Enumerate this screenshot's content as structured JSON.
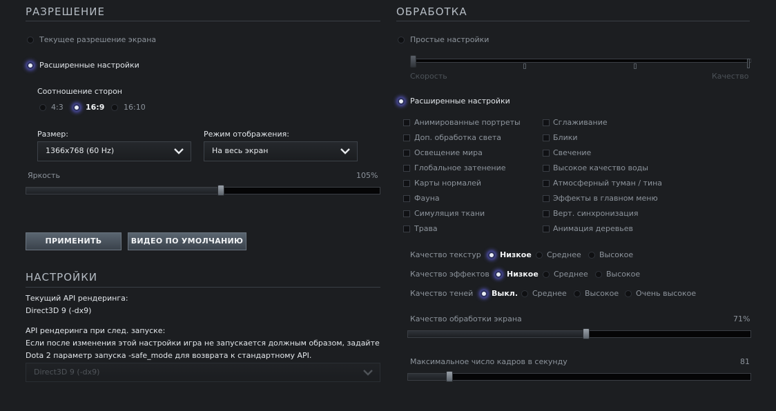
{
  "resolution": {
    "title": "РАЗРЕШЕНИЕ",
    "current_res_label": "Текущее разрешение экрана",
    "advanced_label": "Расширенные настройки",
    "aspect_label": "Соотношение сторон",
    "aspect_options": [
      "4:3",
      "16:9",
      "16:10"
    ],
    "size_label": "Размер:",
    "size_value": "1366x768 (60 Hz)",
    "display_mode_label": "Режим отображения:",
    "display_mode_value": "На весь экран",
    "brightness_label": "Яркость",
    "brightness_value": "105%",
    "brightness_fraction": 0.55,
    "apply_label": "ПРИМЕНИТЬ",
    "default_video_label": "ВИДЕО ПО УМОЛЧАНИЮ"
  },
  "settings": {
    "title": "НАСТРОЙКИ",
    "current_api_label": "Текущий API рендеринга:",
    "current_api_value": "Direct3D 9 (-dx9)",
    "next_api_label": "API рендеринга при след. запуске:",
    "warning_line1": "Если после изменения этой настройки игра не запускается должным образом, задайте",
    "warning_line2": "Dota 2 параметр запуска -safe_mode для возврата к стандартному API.",
    "api_select_value": "Direct3D 9 (-dx9)"
  },
  "rendering": {
    "title": "ОБРАБОТКА",
    "simple_label": "Простые настройки",
    "speed_label": "Скорость",
    "quality_label": "Качество",
    "advanced_label": "Расширенные настройки",
    "checkboxes_left": [
      "Анимированные портреты",
      "Доп. обработка света",
      "Освещение мира",
      "Глобальное затенение",
      "Карты нормалей",
      "Фауна",
      "Симуляция ткани",
      "Трава"
    ],
    "checkboxes_right": [
      "Сглаживание",
      "Блики",
      "Свечение",
      "Высокое качество воды",
      "Атмосферный туман / тина",
      "Эффекты в главном меню",
      "Верт. синхронизация",
      "Анимация деревьев"
    ],
    "texture_quality_label": "Качество текстур",
    "texture_options": [
      "Низкое",
      "Среднее",
      "Высокое"
    ],
    "effects_quality_label": "Качество эффектов",
    "effects_options": [
      "Низкое",
      "Среднее",
      "Высокое"
    ],
    "shadow_quality_label": "Качество теней",
    "shadow_options": [
      "Выкл.",
      "Среднее",
      "Высокое",
      "Очень высокое"
    ],
    "screen_quality_label": "Качество обработки экрана",
    "screen_quality_value": "71%",
    "screen_quality_fraction": 0.52,
    "max_fps_label": "Максимальное число кадров в секунду",
    "max_fps_value": "81",
    "max_fps_fraction": 0.12
  },
  "colors": {
    "background": "#1c1e21",
    "accent_glow": "#6e6eff"
  }
}
